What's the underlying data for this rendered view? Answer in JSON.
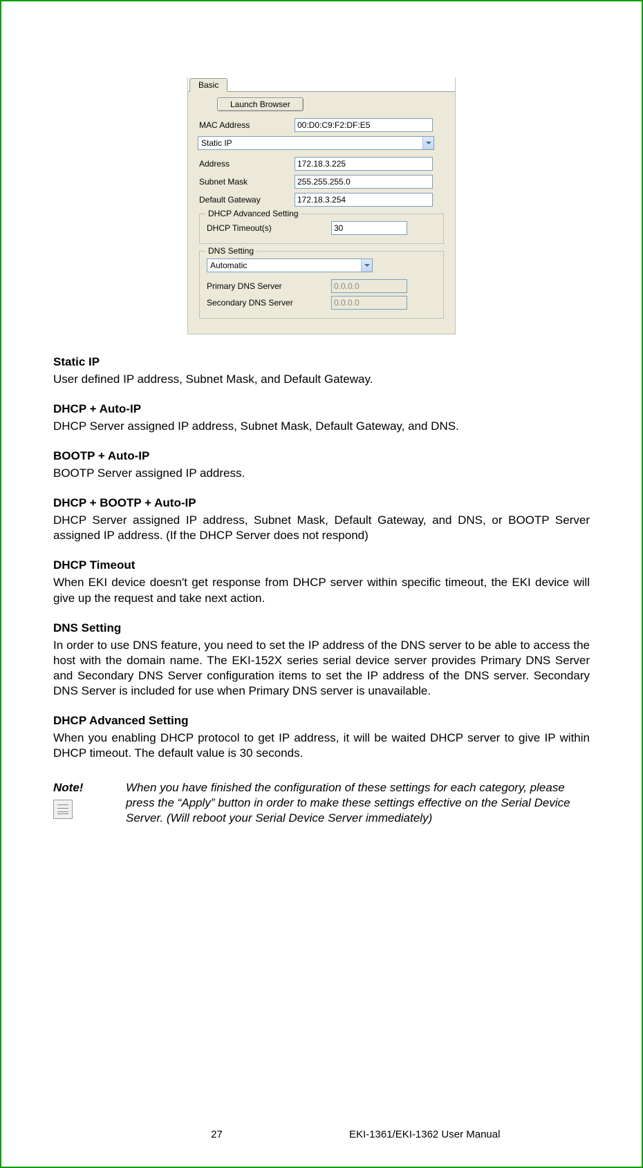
{
  "screenshot": {
    "tab": "Basic",
    "launch_button": "Launch Browser",
    "mac_label": "MAC Address",
    "mac_value": "00:D0:C9:F2:DF:E5",
    "mode_select": "Static IP",
    "address_label": "Address",
    "address_value": "172.18.3.225",
    "subnet_label": "Subnet Mask",
    "subnet_value": "255.255.255.0",
    "gateway_label": "Default Gateway",
    "gateway_value": "172.18.3.254",
    "dhcp_group": "DHCP Advanced Setting",
    "dhcp_timeout_label": "DHCP Timeout(s)",
    "dhcp_timeout_value": "30",
    "dns_group": "DNS Setting",
    "dns_mode": "Automatic",
    "primary_dns_label": "Primary DNS Server",
    "primary_dns_value": "0.0.0.0",
    "secondary_dns_label": "Secondary DNS Server",
    "secondary_dns_value": "0.0.0.0"
  },
  "sections": {
    "static_ip": {
      "heading": "Static IP",
      "body": "User defined IP address, Subnet Mask, and Default Gateway."
    },
    "dhcp_auto": {
      "heading": "DHCP + Auto-IP",
      "body": "DHCP Server assigned IP address, Subnet Mask, Default Gateway, and DNS."
    },
    "bootp_auto": {
      "heading": "BOOTP + Auto-IP",
      "body": "BOOTP Server assigned IP address."
    },
    "dhcp_bootp_auto": {
      "heading": "DHCP + BOOTP + Auto-IP",
      "body": "DHCP Server assigned IP address, Subnet Mask, Default Gateway, and DNS, or BOOTP Server assigned IP address. (If the DHCP Server does not respond)"
    },
    "dhcp_timeout": {
      "heading": "DHCP Timeout",
      "body": "When EKI device doesn't get response from DHCP server within specific timeout, the EKI device will give up the request and take next action."
    },
    "dns_setting": {
      "heading": "DNS Setting",
      "body": "In order to use DNS feature, you need to set the IP address of the DNS server to be able to access the host with the domain name. The EKI-152X series serial device server provides Primary DNS Server and Secondary DNS Server configuration items to set the IP address of the DNS server. Secondary DNS Server is included for use when Primary DNS server is unavailable."
    },
    "dhcp_advanced": {
      "heading": "DHCP Advanced Setting",
      "body": "When you enabling DHCP protocol to get IP address, it will be waited DHCP server to give IP within DHCP timeout. The default value is 30 seconds."
    }
  },
  "note": {
    "label": "Note!",
    "body": "When you have finished the configuration of these settings for each category, please press the “Apply” button in order to make these settings effective on the Serial Device Server. (Will reboot your Serial Device Server immediately)"
  },
  "footer": {
    "page": "27",
    "title": "EKI-1361/EKI-1362 User Manual"
  }
}
